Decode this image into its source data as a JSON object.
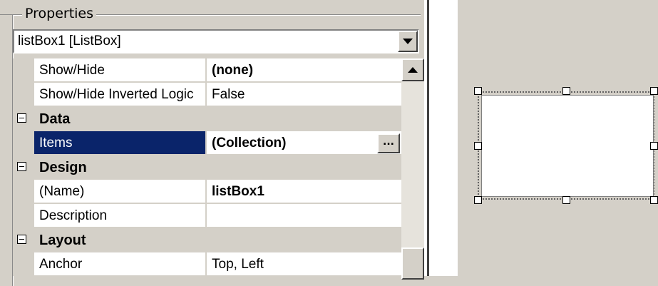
{
  "properties_panel": {
    "group_title": "Properties",
    "object_selector": {
      "value": "listBox1 [ListBox]"
    },
    "rows": [
      {
        "kind": "prop",
        "name": "Show/Hide",
        "value": "(none)",
        "bold": true
      },
      {
        "kind": "prop",
        "name": "Show/Hide Inverted Logic",
        "value": "False",
        "bold": false
      },
      {
        "kind": "category",
        "label": "Data"
      },
      {
        "kind": "prop",
        "name": "Items",
        "value": "(Collection)",
        "bold": true,
        "selected": true,
        "has_button": true
      },
      {
        "kind": "category",
        "label": "Design"
      },
      {
        "kind": "prop",
        "name": "(Name)",
        "value": "listBox1",
        "bold": true
      },
      {
        "kind": "prop",
        "name": "Description",
        "value": "",
        "bold": false
      },
      {
        "kind": "category",
        "label": "Layout"
      },
      {
        "kind": "prop",
        "name": "Anchor",
        "value": "Top, Left",
        "bold": false
      }
    ],
    "ellipsis_label": "...",
    "icons": {
      "dropdown": "chevron-down-icon",
      "scroll_up": "arrow-up-icon",
      "collapse": "minus-box-icon"
    }
  },
  "colors": {
    "selection": "#0a246a",
    "face": "#d4d0c8"
  }
}
